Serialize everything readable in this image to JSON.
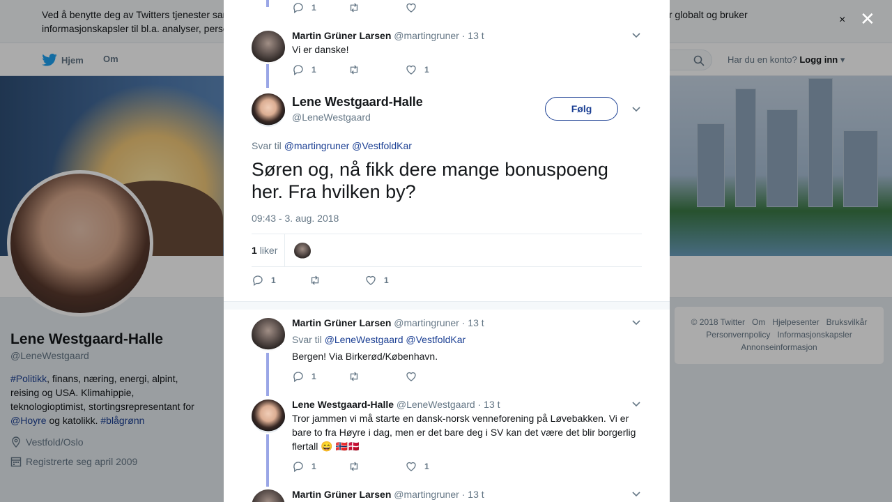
{
  "cookie": {
    "text": "Ved å benytte deg av Twitters tjenester samtykker du i vår bruk av informasjonskapsler og dataoverføring utenfor EU. Vi og våre partnere opererer globalt og bruker informasjonskapsler til bl.a. analyser, personalisering og annonser.",
    "close": "×"
  },
  "nav": {
    "home": "Hjem",
    "about": "Om",
    "account_q": "Har du en konto?",
    "login": "Logg inn"
  },
  "overlay_close": "✕",
  "profile": {
    "name": "Lene Westgaard-Halle",
    "handle": "@LeneWestgaard",
    "bio": {
      "tag1": "#Politikk",
      "line1": ", finans, næring, energi, alpint, reising og USA. Klimahippie, teknologioptimist, stortingsrepresentant for",
      "mention": "@Hoyre",
      "mid": " og katolikk. ",
      "tag2": "#blågrønn"
    },
    "location": "Vestfold/Oslo",
    "joined": "Registrerte seg april 2009"
  },
  "footer": {
    "copyright": "© 2018 Twitter",
    "about": "Om",
    "help": "Hjelpesenter",
    "terms": "Bruksvilkår",
    "privacy": "Personvernpolicy",
    "cookies": "Informasjonskapsler",
    "ads": "Annonseinformasjon"
  },
  "thread": {
    "top_actions": {
      "replies": "1",
      "retweets": "",
      "likes": ""
    },
    "prev_tweet": {
      "name": "Martin Grüner Larsen",
      "handle": "@martingruner",
      "time": "· 13 t",
      "text": "Vi er danske!",
      "replies": "1",
      "retweets": "",
      "likes": "1"
    },
    "main_tweet": {
      "name": "Lene Westgaard-Halle",
      "handle": "@LeneWestgaard",
      "follow": "Følg",
      "reply_prefix": "Svar til",
      "reply_mention1": "@martingruner",
      "reply_mention2": "@VestfoldKar",
      "text": "Søren og, nå fikk dere mange bonuspoeng her. Fra hvilken by?",
      "timestamp": "09:43 - 3. aug. 2018",
      "likes_count": "1",
      "likes_label": "liker",
      "replies": "1",
      "retweets": "",
      "likes": "1"
    },
    "replies": [
      {
        "name": "Martin Grüner Larsen",
        "handle": "@martingruner",
        "time": "· 13 t",
        "reply_prefix": "Svar til",
        "reply_mention1": "@LeneWestgaard",
        "reply_mention2": "@VestfoldKar",
        "text": "Bergen! Via Birkerød/København.",
        "replies": "1",
        "retweets": "",
        "likes": ""
      },
      {
        "name": "Lene Westgaard-Halle",
        "handle": "@LeneWestgaard",
        "time": "· 13 t",
        "text": "Tror jammen vi må starte en dansk-norsk venneforening på Løvebakken. Vi er bare to fra Høyre i dag, men er det bare deg i SV kan det være det blir borgerlig flertall",
        "emoji": "😄 🇳🇴🇩🇰",
        "replies": "1",
        "retweets": "",
        "likes": "1"
      },
      {
        "name": "Martin Grüner Larsen",
        "handle": "@martingruner",
        "time": "· 13 t"
      }
    ]
  },
  "colors": {
    "link": "#1b3f93",
    "thread_line": "#9aa6e6",
    "muted": "#657786"
  },
  "icons": [
    "reply-icon",
    "retweet-icon",
    "heart-icon",
    "chevron-down-icon",
    "location-icon",
    "calendar-icon",
    "search-icon",
    "twitter-bird-icon"
  ]
}
